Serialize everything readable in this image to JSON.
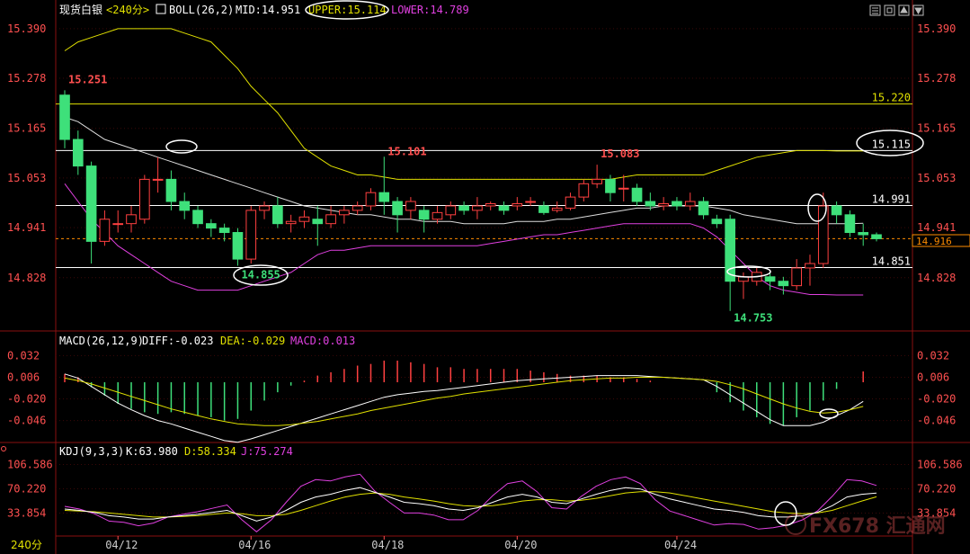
{
  "header": {
    "title": "现货白银",
    "period": "<240分>",
    "indicator_name": "BOLL(26,2)",
    "mid_label": "MID:14.951",
    "upper_label": "UPPER:15.114",
    "lower_label": "LOWER:14.789"
  },
  "toolbar": {
    "icons": [
      "list-icon",
      "frame-icon",
      "up-icon",
      "down-icon"
    ]
  },
  "macd_header": {
    "name": "MACD(26,12,9)",
    "diff_label": "DIFF:-0.023",
    "dea_label": "DEA:-0.029",
    "macd_label": "MACD:0.013"
  },
  "kdj_header": {
    "name": "KDJ(9,3,3)",
    "k_label": "K:63.980",
    "d_label": "D:58.334",
    "j_label": "J:75.274"
  },
  "bottom_period": "240分",
  "watermark": "FX678 汇通网",
  "colors": {
    "up": "#ff4040",
    "down": "#3ee07a",
    "mid": "#ffffff",
    "upper": "#e0e000",
    "lower": "#e040e0",
    "axis": "#ff5050",
    "dea": "#e0e000",
    "j": "#e040e0",
    "grid": "#8a1010",
    "last_price": "#ff8c00"
  },
  "chart_data": [
    {
      "type": "candlestick",
      "title": "现货白银",
      "x_ticks": [
        "04/12",
        "04/16",
        "04/18",
        "04/20",
        "04/24"
      ],
      "y_ticks": [
        "15.390",
        "15.278",
        "15.165",
        "15.053",
        "14.941",
        "14.828"
      ],
      "ylim": [
        14.72,
        15.41
      ],
      "candles": [
        {
          "o": 15.24,
          "h": 15.251,
          "l": 15.12,
          "c": 15.14
        },
        {
          "o": 15.14,
          "h": 15.16,
          "l": 15.06,
          "c": 15.08
        },
        {
          "o": 15.08,
          "h": 15.09,
          "l": 14.86,
          "c": 14.91
        },
        {
          "o": 14.91,
          "h": 14.98,
          "l": 14.9,
          "c": 14.96
        },
        {
          "o": 14.95,
          "h": 14.98,
          "l": 14.93,
          "c": 14.95
        },
        {
          "o": 14.95,
          "h": 14.99,
          "l": 14.93,
          "c": 14.97
        },
        {
          "o": 14.96,
          "h": 15.06,
          "l": 14.95,
          "c": 15.05
        },
        {
          "o": 15.05,
          "h": 15.1,
          "l": 15.02,
          "c": 15.05
        },
        {
          "o": 15.05,
          "h": 15.07,
          "l": 14.98,
          "c": 15.0
        },
        {
          "o": 15.0,
          "h": 15.02,
          "l": 14.96,
          "c": 14.98
        },
        {
          "o": 14.98,
          "h": 14.99,
          "l": 14.94,
          "c": 14.95
        },
        {
          "o": 14.95,
          "h": 14.96,
          "l": 14.92,
          "c": 14.94
        },
        {
          "o": 14.94,
          "h": 14.95,
          "l": 14.91,
          "c": 14.93
        },
        {
          "o": 14.93,
          "h": 14.94,
          "l": 14.855,
          "c": 14.87
        },
        {
          "o": 14.87,
          "h": 14.99,
          "l": 14.86,
          "c": 14.98
        },
        {
          "o": 14.98,
          "h": 15.0,
          "l": 14.96,
          "c": 14.99
        },
        {
          "o": 14.99,
          "h": 15.01,
          "l": 14.94,
          "c": 14.95
        },
        {
          "o": 14.95,
          "h": 14.97,
          "l": 14.93,
          "c": 14.955
        },
        {
          "o": 14.955,
          "h": 14.98,
          "l": 14.94,
          "c": 14.965
        },
        {
          "o": 14.96,
          "h": 14.99,
          "l": 14.9,
          "c": 14.95
        },
        {
          "o": 14.95,
          "h": 14.99,
          "l": 14.94,
          "c": 14.97
        },
        {
          "o": 14.97,
          "h": 14.99,
          "l": 14.95,
          "c": 14.98
        },
        {
          "o": 14.98,
          "h": 15.0,
          "l": 14.97,
          "c": 14.99
        },
        {
          "o": 14.99,
          "h": 15.03,
          "l": 14.98,
          "c": 15.02
        },
        {
          "o": 15.02,
          "h": 15.101,
          "l": 14.97,
          "c": 15.0
        },
        {
          "o": 15.0,
          "h": 15.01,
          "l": 14.93,
          "c": 14.97
        },
        {
          "o": 14.98,
          "h": 15.01,
          "l": 14.96,
          "c": 15.0
        },
        {
          "o": 14.98,
          "h": 14.99,
          "l": 14.93,
          "c": 14.96
        },
        {
          "o": 14.96,
          "h": 14.99,
          "l": 14.95,
          "c": 14.975
        },
        {
          "o": 14.97,
          "h": 15.0,
          "l": 14.96,
          "c": 14.99
        },
        {
          "o": 14.99,
          "h": 15.0,
          "l": 14.97,
          "c": 14.98
        },
        {
          "o": 14.98,
          "h": 15.01,
          "l": 14.96,
          "c": 14.99
        },
        {
          "o": 14.99,
          "h": 15.0,
          "l": 14.98,
          "c": 14.995
        },
        {
          "o": 14.99,
          "h": 15.0,
          "l": 14.97,
          "c": 14.98
        },
        {
          "o": 14.99,
          "h": 15.01,
          "l": 14.98,
          "c": 14.995
        },
        {
          "o": 15.0,
          "h": 15.01,
          "l": 14.99,
          "c": 15.0
        },
        {
          "o": 14.99,
          "h": 15.0,
          "l": 14.97,
          "c": 14.975
        },
        {
          "o": 14.98,
          "h": 15.0,
          "l": 14.975,
          "c": 14.985
        },
        {
          "o": 14.985,
          "h": 15.02,
          "l": 14.98,
          "c": 15.01
        },
        {
          "o": 15.01,
          "h": 15.05,
          "l": 15.0,
          "c": 15.04
        },
        {
          "o": 15.04,
          "h": 15.083,
          "l": 15.03,
          "c": 15.05
        },
        {
          "o": 15.05,
          "h": 15.06,
          "l": 15.0,
          "c": 15.02
        },
        {
          "o": 15.03,
          "h": 15.06,
          "l": 15.0,
          "c": 15.03
        },
        {
          "o": 15.03,
          "h": 15.04,
          "l": 14.99,
          "c": 15.0
        },
        {
          "o": 15.0,
          "h": 15.02,
          "l": 14.98,
          "c": 14.99
        },
        {
          "o": 14.99,
          "h": 15.01,
          "l": 14.98,
          "c": 14.995
        },
        {
          "o": 15.0,
          "h": 15.01,
          "l": 14.98,
          "c": 14.99
        },
        {
          "o": 14.99,
          "h": 15.02,
          "l": 14.98,
          "c": 15.0
        },
        {
          "o": 15.0,
          "h": 15.01,
          "l": 14.96,
          "c": 14.97
        },
        {
          "o": 14.96,
          "h": 14.97,
          "l": 14.94,
          "c": 14.95
        },
        {
          "o": 14.96,
          "h": 14.97,
          "l": 14.753,
          "c": 14.82
        },
        {
          "o": 14.82,
          "h": 14.84,
          "l": 14.78,
          "c": 14.83
        },
        {
          "o": 14.82,
          "h": 14.85,
          "l": 14.81,
          "c": 14.84
        },
        {
          "o": 14.83,
          "h": 14.84,
          "l": 14.8,
          "c": 14.82
        },
        {
          "o": 14.82,
          "h": 14.83,
          "l": 14.79,
          "c": 14.81
        },
        {
          "o": 14.81,
          "h": 14.87,
          "l": 14.8,
          "c": 14.85
        },
        {
          "o": 14.85,
          "h": 14.88,
          "l": 14.81,
          "c": 14.86
        },
        {
          "o": 14.86,
          "h": 15.02,
          "l": 14.85,
          "c": 14.99
        },
        {
          "o": 14.99,
          "h": 15.0,
          "l": 14.95,
          "c": 14.97
        },
        {
          "o": 14.97,
          "h": 14.98,
          "l": 14.92,
          "c": 14.93
        },
        {
          "o": 14.93,
          "h": 14.95,
          "l": 14.9,
          "c": 14.925
        },
        {
          "o": 14.925,
          "h": 14.93,
          "l": 14.91,
          "c": 14.916
        }
      ],
      "mid_line": [
        15.19,
        15.18,
        15.16,
        15.14,
        15.13,
        15.12,
        15.11,
        15.1,
        15.09,
        15.08,
        15.07,
        15.06,
        15.05,
        15.04,
        15.03,
        15.02,
        15.01,
        15.0,
        14.99,
        14.985,
        14.98,
        14.975,
        14.97,
        14.97,
        14.965,
        14.96,
        14.96,
        14.955,
        14.955,
        14.955,
        14.95,
        14.95,
        14.95,
        14.95,
        14.955,
        14.955,
        14.955,
        14.96,
        14.96,
        14.965,
        14.97,
        14.975,
        14.98,
        14.985,
        14.985,
        14.99,
        14.99,
        14.99,
        14.99,
        14.985,
        14.98,
        14.97,
        14.965,
        14.96,
        14.955,
        14.95,
        14.95,
        14.95,
        14.95,
        14.95,
        14.951
      ],
      "upper_line": [
        15.34,
        15.36,
        15.37,
        15.38,
        15.39,
        15.39,
        15.39,
        15.39,
        15.39,
        15.38,
        15.37,
        15.36,
        15.33,
        15.3,
        15.26,
        15.23,
        15.2,
        15.16,
        15.12,
        15.1,
        15.08,
        15.07,
        15.06,
        15.06,
        15.055,
        15.05,
        15.05,
        15.05,
        15.05,
        15.05,
        15.05,
        15.05,
        15.05,
        15.05,
        15.05,
        15.05,
        15.05,
        15.05,
        15.05,
        15.05,
        15.05,
        15.05,
        15.055,
        15.06,
        15.06,
        15.06,
        15.06,
        15.06,
        15.06,
        15.07,
        15.08,
        15.09,
        15.1,
        15.105,
        15.11,
        15.115,
        15.115,
        15.115,
        15.114,
        15.114,
        15.114
      ],
      "lower_line": [
        15.04,
        15.0,
        14.96,
        14.93,
        14.9,
        14.88,
        14.86,
        14.84,
        14.82,
        14.81,
        14.8,
        14.8,
        14.8,
        14.8,
        14.81,
        14.82,
        14.83,
        14.84,
        14.86,
        14.88,
        14.89,
        14.89,
        14.895,
        14.9,
        14.9,
        14.9,
        14.9,
        14.9,
        14.9,
        14.9,
        14.9,
        14.9,
        14.905,
        14.91,
        14.915,
        14.92,
        14.925,
        14.925,
        14.93,
        14.935,
        14.94,
        14.945,
        14.95,
        14.95,
        14.95,
        14.95,
        14.95,
        14.95,
        14.94,
        14.92,
        14.89,
        14.86,
        14.83,
        14.81,
        14.8,
        14.795,
        14.79,
        14.79,
        14.789,
        14.789,
        14.789
      ],
      "horizontal_levels": [
        15.22,
        15.115,
        14.991,
        14.851
      ],
      "last_price": "14.916",
      "annotations": [
        "15.251",
        "15.101",
        "15.083",
        "14.855",
        "14.753",
        "15.220",
        "15.115",
        "14.991",
        "14.851"
      ]
    },
    {
      "type": "line",
      "title": "MACD(26,12,9)",
      "y_ticks": [
        "0.032",
        "0.006",
        "-0.020",
        "-0.046"
      ],
      "ylim": [
        -0.068,
        0.04
      ],
      "diff": [
        0.01,
        0.005,
        -0.005,
        -0.015,
        -0.025,
        -0.033,
        -0.04,
        -0.046,
        -0.05,
        -0.055,
        -0.06,
        -0.065,
        -0.07,
        -0.072,
        -0.068,
        -0.063,
        -0.058,
        -0.053,
        -0.048,
        -0.043,
        -0.038,
        -0.033,
        -0.028,
        -0.023,
        -0.018,
        -0.015,
        -0.013,
        -0.011,
        -0.01,
        -0.008,
        -0.006,
        -0.004,
        -0.002,
        0.0,
        0.002,
        0.003,
        0.004,
        0.005,
        0.006,
        0.007,
        0.008,
        0.008,
        0.008,
        0.008,
        0.007,
        0.006,
        0.005,
        0.004,
        0.003,
        -0.005,
        -0.015,
        -0.025,
        -0.035,
        -0.045,
        -0.052,
        -0.052,
        -0.052,
        -0.048,
        -0.04,
        -0.033,
        -0.023
      ],
      "dea": [
        0.005,
        0.002,
        -0.002,
        -0.007,
        -0.012,
        -0.017,
        -0.022,
        -0.027,
        -0.032,
        -0.036,
        -0.04,
        -0.044,
        -0.047,
        -0.05,
        -0.051,
        -0.052,
        -0.052,
        -0.051,
        -0.049,
        -0.047,
        -0.044,
        -0.041,
        -0.038,
        -0.034,
        -0.031,
        -0.028,
        -0.025,
        -0.022,
        -0.019,
        -0.017,
        -0.014,
        -0.012,
        -0.01,
        -0.008,
        -0.006,
        -0.004,
        -0.002,
        0.0,
        0.002,
        0.003,
        0.004,
        0.005,
        0.005,
        0.006,
        0.006,
        0.006,
        0.005,
        0.004,
        0.003,
        0.001,
        -0.003,
        -0.008,
        -0.014,
        -0.02,
        -0.026,
        -0.031,
        -0.035,
        -0.037,
        -0.036,
        -0.033,
        -0.029
      ],
      "macd": [
        0.01,
        0.006,
        -0.006,
        -0.016,
        -0.026,
        -0.032,
        -0.036,
        -0.038,
        -0.036,
        -0.038,
        -0.04,
        -0.042,
        -0.046,
        -0.044,
        -0.034,
        -0.022,
        -0.012,
        -0.004,
        0.002,
        0.008,
        0.012,
        0.016,
        0.02,
        0.022,
        0.026,
        0.026,
        0.024,
        0.022,
        0.018,
        0.018,
        0.016,
        0.016,
        0.016,
        0.016,
        0.016,
        0.014,
        0.012,
        0.01,
        0.008,
        0.008,
        0.008,
        0.006,
        0.006,
        0.004,
        0.002,
        0.0,
        0.0,
        0.0,
        0.0,
        -0.012,
        -0.024,
        -0.034,
        -0.042,
        -0.05,
        -0.052,
        -0.042,
        -0.034,
        -0.022,
        -0.008,
        0.0,
        0.013
      ]
    },
    {
      "type": "line",
      "title": "KDJ(9,3,3)",
      "y_ticks": [
        "106.586",
        "70.220",
        "33.854"
      ],
      "ylim": [
        5,
        118
      ],
      "k": [
        40,
        38,
        35,
        30,
        28,
        25,
        25,
        28,
        30,
        32,
        35,
        38,
        30,
        22,
        28,
        38,
        50,
        58,
        62,
        68,
        72,
        65,
        58,
        50,
        48,
        45,
        40,
        38,
        42,
        50,
        58,
        62,
        58,
        50,
        48,
        55,
        62,
        68,
        72,
        70,
        62,
        55,
        50,
        45,
        40,
        38,
        35,
        30,
        28,
        28,
        30,
        35,
        45,
        58,
        62,
        63.98
      ],
      "d": [
        38,
        37,
        36,
        34,
        32,
        30,
        28,
        28,
        29,
        30,
        32,
        34,
        33,
        30,
        30,
        32,
        38,
        45,
        52,
        58,
        62,
        64,
        62,
        58,
        55,
        52,
        48,
        45,
        44,
        45,
        48,
        52,
        54,
        54,
        52,
        53,
        56,
        60,
        64,
        66,
        66,
        64,
        60,
        56,
        52,
        48,
        44,
        40,
        36,
        34,
        33,
        34,
        38,
        45,
        52,
        58.334
      ],
      "j": [
        44,
        40,
        33,
        22,
        20,
        15,
        19,
        28,
        32,
        36,
        41,
        46,
        24,
        6,
        24,
        50,
        74,
        84,
        82,
        88,
        92,
        67,
        50,
        34,
        34,
        31,
        24,
        24,
        38,
        60,
        78,
        82,
        66,
        42,
        40,
        59,
        74,
        84,
        88,
        78,
        54,
        37,
        30,
        23,
        16,
        18,
        17,
        10,
        12,
        16,
        24,
        37,
        59,
        84,
        82,
        75.274
      ]
    }
  ]
}
